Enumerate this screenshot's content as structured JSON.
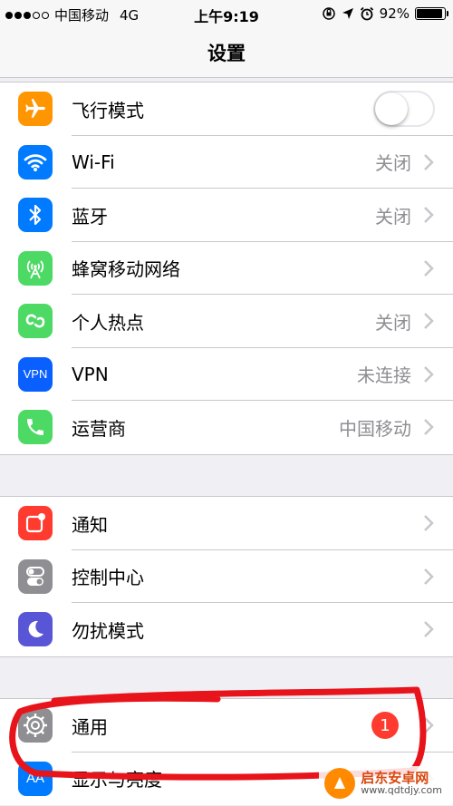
{
  "status_bar": {
    "carrier": "中国移动",
    "network": "4G",
    "time": "上午9:19",
    "battery": "92%",
    "battery_level": 0.92
  },
  "nav": {
    "title": "设置"
  },
  "groups": [
    {
      "rows": [
        {
          "label": "飞行模式",
          "value": "",
          "icon": "airplane-icon",
          "color": "#ff9500",
          "control": "toggle",
          "toggle_on": false
        },
        {
          "label": "Wi-Fi",
          "value": "关闭",
          "icon": "wifi-icon",
          "color": "#007aff"
        },
        {
          "label": "蓝牙",
          "value": "关闭",
          "icon": "bluetooth-icon",
          "color": "#007aff"
        },
        {
          "label": "蜂窝移动网络",
          "value": "",
          "icon": "cellular-icon",
          "color": "#4cd964"
        },
        {
          "label": "个人热点",
          "value": "关闭",
          "icon": "hotspot-icon",
          "color": "#4cd964"
        },
        {
          "label": "VPN",
          "value": "未连接",
          "icon": "vpn-icon",
          "icon_text": "VPN",
          "color": "#0a60ff"
        },
        {
          "label": "运营商",
          "value": "中国移动",
          "icon": "phone-icon",
          "color": "#4cd964"
        }
      ]
    },
    {
      "rows": [
        {
          "label": "通知",
          "value": "",
          "icon": "notifications-icon",
          "color": "#ff3b30"
        },
        {
          "label": "控制中心",
          "value": "",
          "icon": "control-center-icon",
          "color": "#8e8e93"
        },
        {
          "label": "勿扰模式",
          "value": "",
          "icon": "moon-icon",
          "color": "#5856d6"
        }
      ]
    },
    {
      "rows": [
        {
          "label": "通用",
          "value": "",
          "icon": "gear-icon",
          "color": "#8e8e93",
          "badge": "1"
        },
        {
          "label": "显示与亮度",
          "value": "",
          "icon": "display-brightness-icon",
          "icon_text": "AA",
          "color": "#007aff"
        }
      ]
    }
  ],
  "watermark": {
    "title": "启东安卓网",
    "url": "www.qdtdjy.com"
  }
}
